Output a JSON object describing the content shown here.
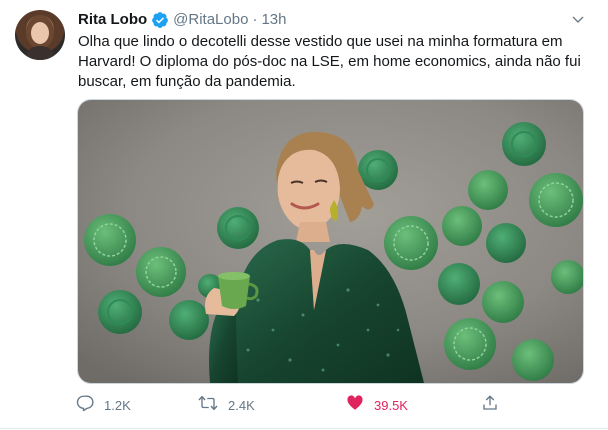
{
  "tweet": {
    "author_name": "Rita Lobo",
    "handle": "@RitaLobo",
    "separator": "·",
    "time": "13h",
    "text": "Olha que lindo o decotelli desse vestido que usei na minha formatura em Harvard! O diploma do pós-doc na LSE, em home economics, ainda não fui buscar, em função da pandemia.",
    "media_icon": "photo-of-woman-in-green-sequin-dress",
    "verified_icon": "verified-badge-icon",
    "caret_icon": "chevron-down-icon"
  },
  "actions": {
    "reply": {
      "icon": "reply-icon",
      "count": "1.2K"
    },
    "retweet": {
      "icon": "retweet-icon",
      "count": "2.4K"
    },
    "like": {
      "icon": "heart-icon",
      "count": "39.5K",
      "liked": true
    },
    "share": {
      "icon": "share-icon"
    }
  },
  "colors": {
    "text": "#14171a",
    "muted": "#657786",
    "verified_blue": "#1da1f2",
    "like_red": "#e0245e",
    "dress_green": "#1f4f3a",
    "wall_grey": "#8e8a85"
  }
}
